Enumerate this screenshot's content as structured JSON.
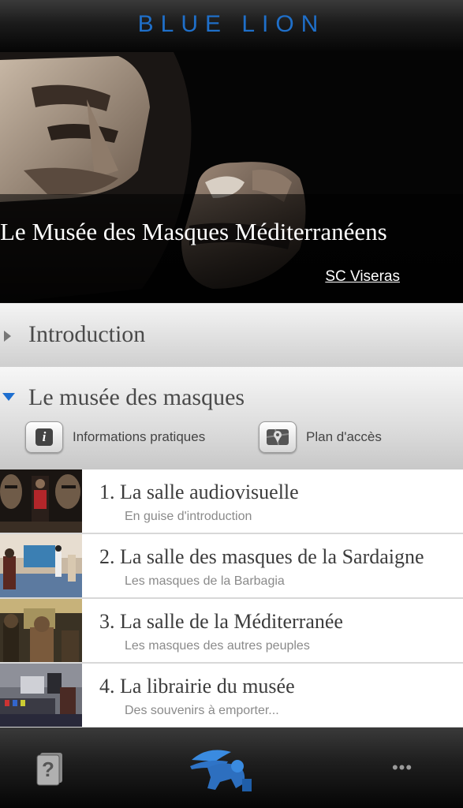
{
  "app": {
    "brand": "BLUE LION",
    "brand_color": "#1f6fc9"
  },
  "hero": {
    "title": "Le Musée des Masques Méditerranéens",
    "author": "SC Viseras"
  },
  "sections": [
    {
      "label": "Introduction",
      "expanded": false
    },
    {
      "label": "Le musée des masques",
      "expanded": true,
      "actions": [
        {
          "label": "Informations pratiques",
          "icon": "info-icon"
        },
        {
          "label": "Plan d'accès",
          "icon": "map-pin-icon"
        }
      ]
    }
  ],
  "rooms": [
    {
      "title": "1. La salle audiovisuelle",
      "subtitle": "En guise d'introduction"
    },
    {
      "title": "2. La salle des masques de la Sardaigne",
      "subtitle": "Les masques de la Barbagia"
    },
    {
      "title": "3. La salle de la Méditerranée",
      "subtitle": "Les masques des autres peuples"
    },
    {
      "title": "4. La librairie du musée",
      "subtitle": "Des souvenirs à emporter..."
    }
  ],
  "tabbar": {
    "items": [
      {
        "icon": "help-book-icon"
      },
      {
        "icon": "winged-lion-logo-icon"
      },
      {
        "label": "•••",
        "icon": "more-icon"
      }
    ]
  }
}
